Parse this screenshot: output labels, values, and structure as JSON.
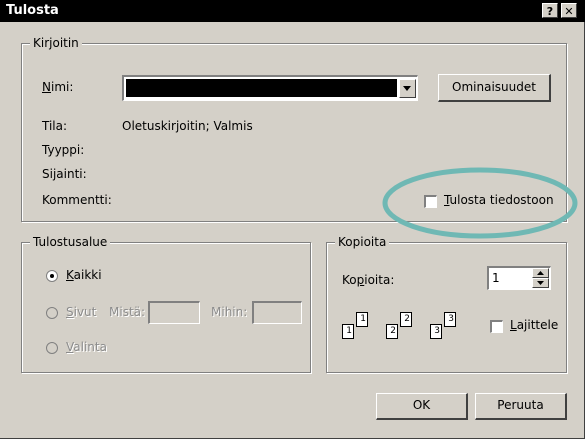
{
  "window": {
    "title": "Tulosta",
    "help_glyph": "?",
    "close_glyph": "✕"
  },
  "printer": {
    "group_label": "Kirjoitin",
    "name_label": "Nimi:",
    "name_value": "",
    "properties_button": "Ominaisuudet",
    "status_label": "Tila:",
    "status_value": "Oletuskirjoitin; Valmis",
    "type_label": "Tyyppi:",
    "type_value": "",
    "where_label": "Sijainti:",
    "where_value": "",
    "comment_label": "Kommentti:",
    "comment_value": "",
    "print_to_file_label": "Tulosta tiedostoon",
    "print_to_file_checked": false,
    "highlight_color": "#6fb8b4"
  },
  "print_range": {
    "group_label": "Tulostusalue",
    "all_label": "Kaikki",
    "all_selected": true,
    "pages_label": "Sivut",
    "from_label": "Mistä:",
    "to_label": "Mihin:",
    "from_value": "",
    "to_value": "",
    "selection_label": "Valinta"
  },
  "copies": {
    "group_label": "Kopioita",
    "count_label": "Kopioita:",
    "count_value": "1",
    "collate_label": "Lajittele",
    "collate_checked": false,
    "page_numbers": [
      "1",
      "1",
      "2",
      "2",
      "3",
      "3"
    ]
  },
  "buttons": {
    "ok": "OK",
    "cancel": "Peruuta"
  }
}
